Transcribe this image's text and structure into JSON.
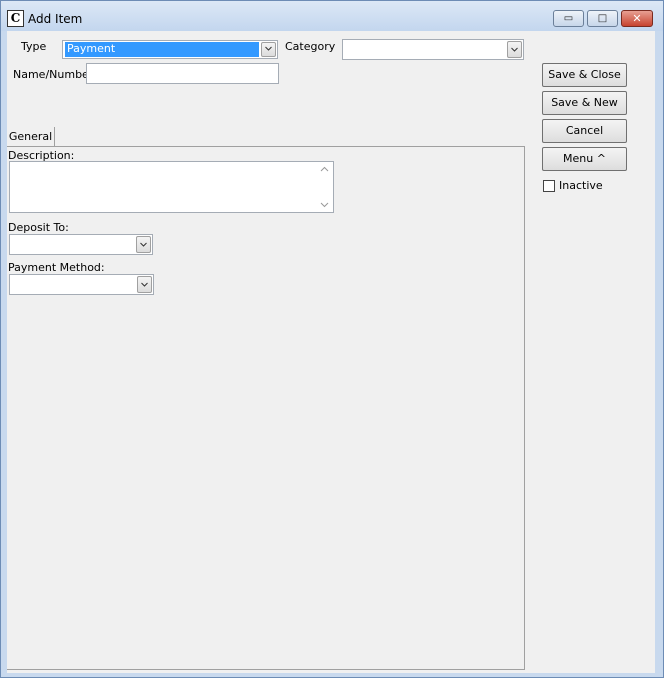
{
  "window": {
    "title": "Add Item",
    "app_icon": "C",
    "buttons": {
      "minimize": "▭",
      "maximize": "□",
      "close": "✕"
    }
  },
  "form": {
    "type_label": "Type",
    "type_value": "Payment",
    "category_label": "Category",
    "category_value": "",
    "name_label": "Name/Number",
    "name_value": ""
  },
  "tabs": [
    {
      "label": "General"
    }
  ],
  "general": {
    "description_label": "Description:",
    "description_value": "",
    "deposit_label": "Deposit To:",
    "deposit_value": "",
    "payment_method_label": "Payment Method:",
    "payment_method_value": ""
  },
  "actions": {
    "save_close": "Save & Close",
    "save_new": "Save & New",
    "cancel": "Cancel",
    "menu": "Menu ^",
    "inactive_label": "Inactive",
    "inactive_checked": false
  },
  "colors": {
    "selection": "#3399ff",
    "titlebar": "#c3d6ee",
    "close_button": "#c7432f"
  }
}
